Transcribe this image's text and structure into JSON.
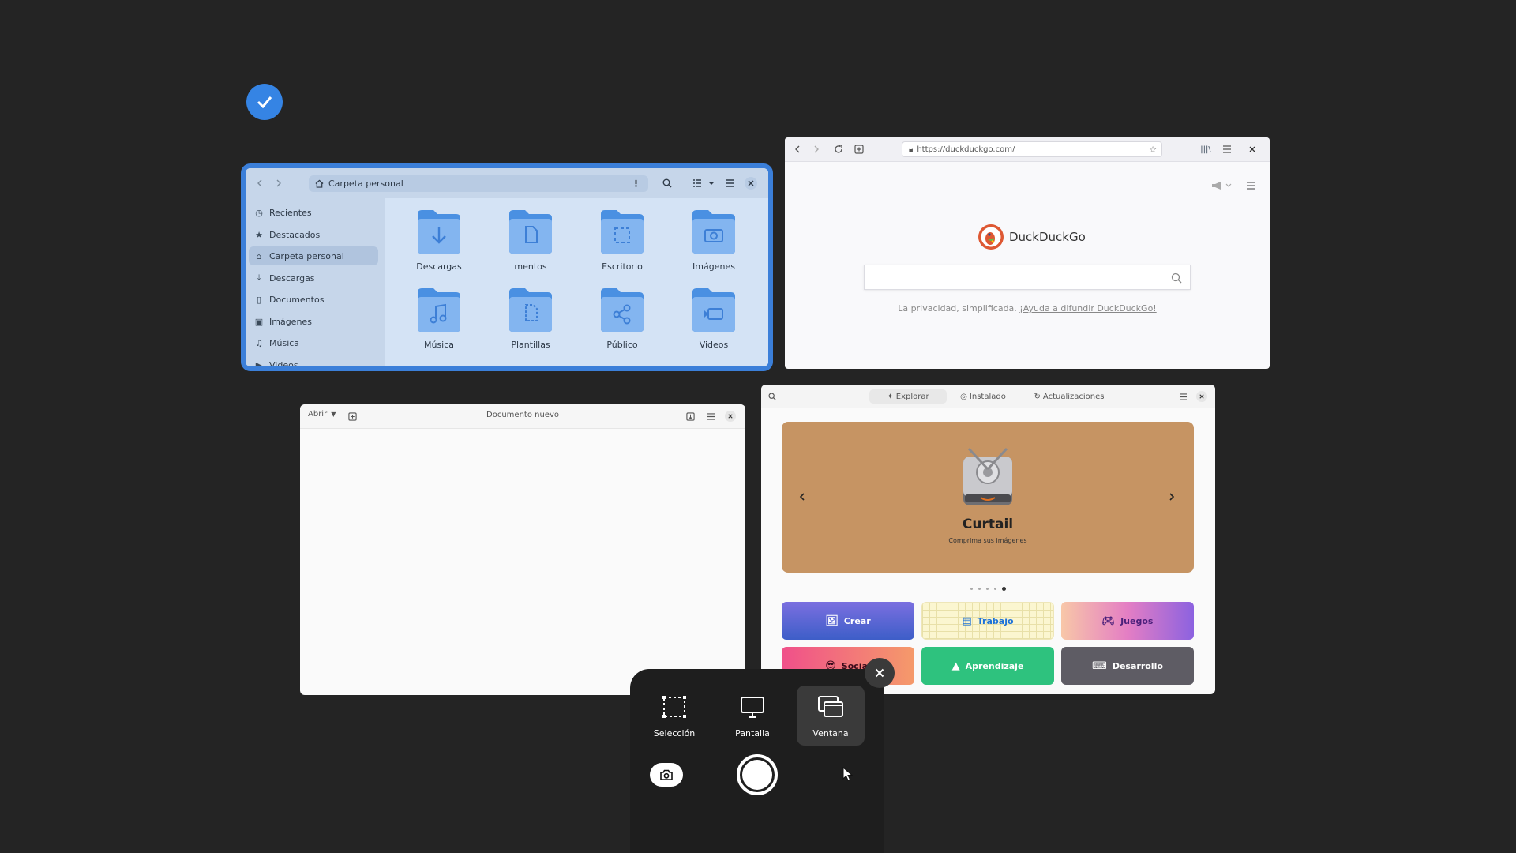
{
  "files": {
    "path": "Carpeta personal",
    "sidebar": [
      {
        "label": "Recientes",
        "icon": "clock-icon"
      },
      {
        "label": "Destacados",
        "icon": "star-icon"
      },
      {
        "label": "Carpeta personal",
        "icon": "home-icon"
      },
      {
        "label": "Descargas",
        "icon": "download-icon"
      },
      {
        "label": "Documentos",
        "icon": "document-icon"
      },
      {
        "label": "Imágenes",
        "icon": "image-icon"
      },
      {
        "label": "Música",
        "icon": "music-icon"
      },
      {
        "label": "Videos",
        "icon": "video-icon"
      }
    ],
    "folders": [
      {
        "label": "Descargas",
        "icon": "download-icon"
      },
      {
        "label": "mentos",
        "icon": "document-icon"
      },
      {
        "label": "Escritorio",
        "icon": "desktop-icon"
      },
      {
        "label": "Imágenes",
        "icon": "camera-icon"
      },
      {
        "label": "Música",
        "icon": "music-icon"
      },
      {
        "label": "Plantillas",
        "icon": "template-icon"
      },
      {
        "label": "Público",
        "icon": "share-icon"
      },
      {
        "label": "Videos",
        "icon": "video-icon"
      }
    ]
  },
  "browser": {
    "url": "https://duckduckgo.com/",
    "brand": "DuckDuckGo",
    "tagline": "La privacidad, simplificada.",
    "tagline_link": "¡Ayuda a difundir DuckDuckGo!"
  },
  "editor": {
    "open_label": "Abrir",
    "title": "Documento nuevo"
  },
  "software": {
    "tabs": [
      {
        "label": "Explorar",
        "icon": "explore-icon"
      },
      {
        "label": "Instalado",
        "icon": "check-circle-icon"
      },
      {
        "label": "Actualizaciones",
        "icon": "refresh-icon"
      }
    ],
    "banner": {
      "title": "Curtail",
      "subtitle": "Comprima sus imágenes"
    },
    "categories": [
      {
        "label": "Crear",
        "color": "#5f6fd6"
      },
      {
        "label": "Trabajo",
        "color": "#f7f2c8"
      },
      {
        "label": "Juegos",
        "color": "#e98fc9"
      },
      {
        "label": "Social",
        "color": "#f06a8a"
      },
      {
        "label": "Aprendizaje",
        "color": "#2ec27e"
      },
      {
        "label": "Desarrollo",
        "color": "#5e5c64"
      }
    ]
  },
  "screenshot_ui": {
    "modes": [
      {
        "label": "Selección",
        "icon": "selection-icon"
      },
      {
        "label": "Pantalla",
        "icon": "screen-icon"
      },
      {
        "label": "Ventana",
        "icon": "window-icon"
      }
    ],
    "active_mode": "Ventana"
  }
}
